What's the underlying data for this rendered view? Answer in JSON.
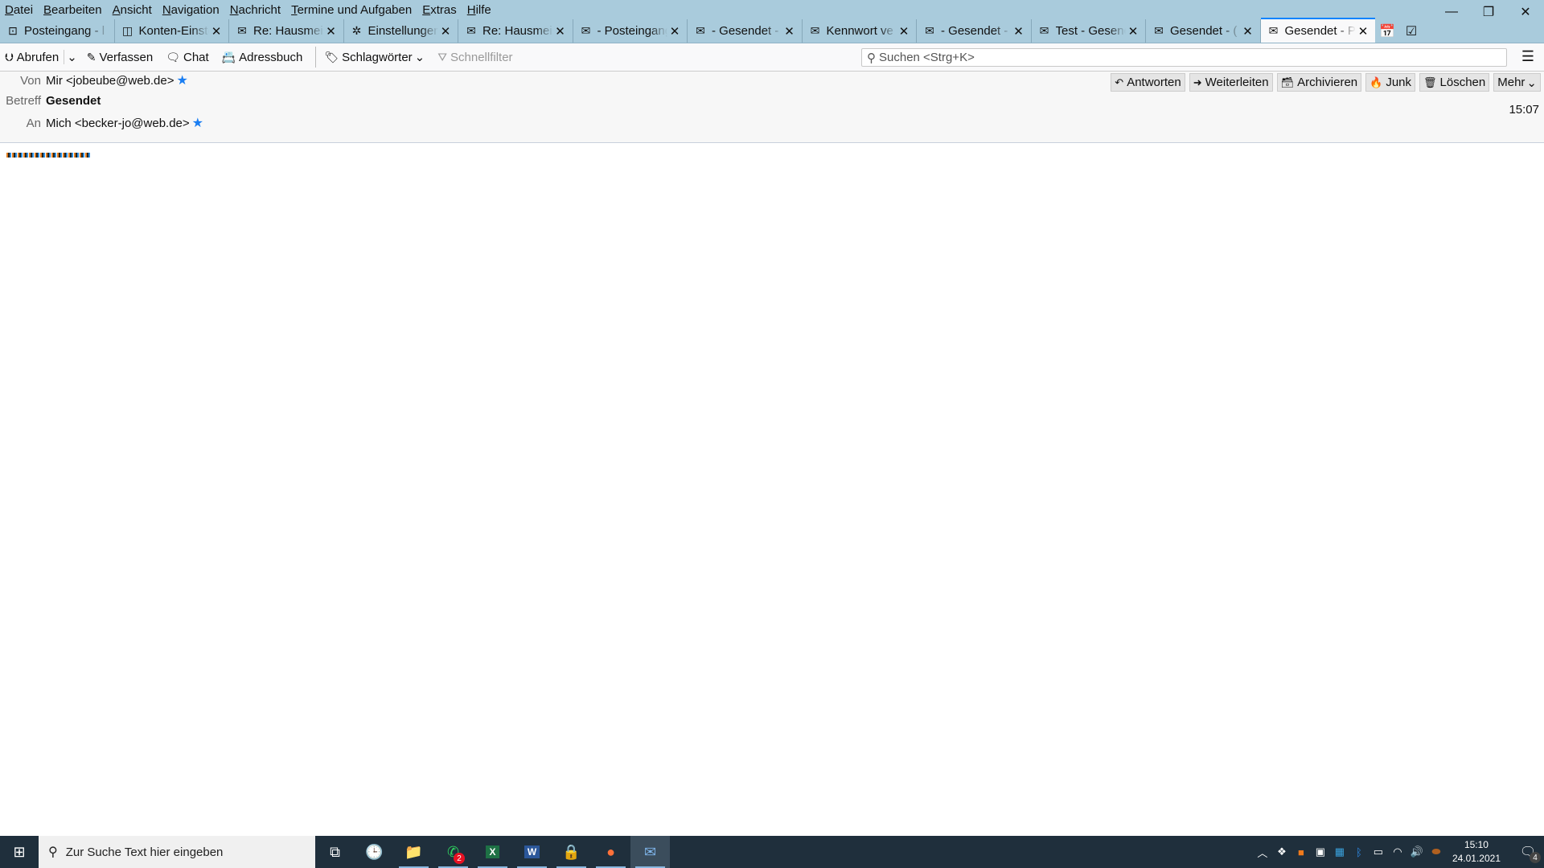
{
  "menubar": {
    "items": [
      "Datei",
      "Bearbeiten",
      "Ansicht",
      "Navigation",
      "Nachricht",
      "Termine und Aufgaben",
      "Extras",
      "Hilfe"
    ]
  },
  "window_controls": {
    "minimize": "—",
    "restore": "❐",
    "close": "✕"
  },
  "tabs": [
    {
      "label": "Posteingang - l",
      "icon": "inbox-icon",
      "closable": false
    },
    {
      "label": "Konten-Einstellungen",
      "icon": "account-icon",
      "closable": true
    },
    {
      "label": "Re: Hausmeister",
      "icon": "mail-icon",
      "closable": true
    },
    {
      "label": "Einstellungen",
      "icon": "gear-icon",
      "closable": true
    },
    {
      "label": "Re: Hausmeister",
      "icon": "mail-icon",
      "closable": true
    },
    {
      "label": "- Posteingang",
      "icon": "mail-icon",
      "closable": true
    },
    {
      "label": "- Gesendet -",
      "icon": "mail-icon",
      "closable": true
    },
    {
      "label": "Kennwort ve",
      "icon": "mail-icon",
      "closable": true
    },
    {
      "label": "- Gesendet -",
      "icon": "mail-icon",
      "closable": true
    },
    {
      "label": "Test - Gesendet",
      "icon": "mail-icon",
      "closable": true
    },
    {
      "label": "Gesendet - (",
      "icon": "mail-icon",
      "closable": true
    },
    {
      "label": "Gesendet - P",
      "icon": "mail-icon",
      "closable": true,
      "active": true
    }
  ],
  "toolbar": {
    "abrufen": "Abrufen",
    "verfassen": "Verfassen",
    "chat": "Chat",
    "adressbuch": "Adressbuch",
    "schlagwoerter": "Schlagwörter",
    "schnellfilter": "Schnellfilter",
    "search_placeholder": "Suchen <Strg+K>"
  },
  "message": {
    "from_label": "Von",
    "from": "Mir <jobeube@web.de>",
    "subject_label": "Betreff",
    "subject": "Gesendet",
    "to_label": "An",
    "to": "Mich <becker-jo@web.de>",
    "time": "15:07",
    "actions": [
      "Antworten",
      "Weiterleiten",
      "Archivieren",
      "Junk",
      "Löschen",
      "Mehr"
    ]
  },
  "taskbar": {
    "search_placeholder": "Zur Suche Text hier eingeben",
    "whatsapp_badge": "2",
    "clock_time": "15:10",
    "clock_date": "24.01.2021",
    "notification_count": "4"
  },
  "colors": {
    "accent": "#0a84ff",
    "titlebar": "#a9cbdc",
    "star": "#1a7ef2",
    "taskbar": "#1f2f3c"
  }
}
